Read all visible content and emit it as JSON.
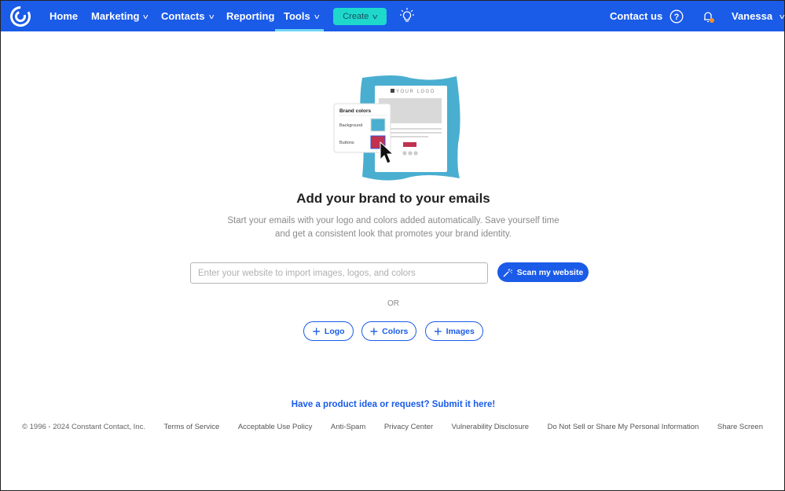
{
  "nav": {
    "items": [
      {
        "label": "Home"
      },
      {
        "label": "Marketing"
      },
      {
        "label": "Contacts"
      },
      {
        "label": "Reporting"
      },
      {
        "label": "Tools"
      }
    ],
    "create_label": "Create",
    "contact_label": "Contact us",
    "user_label": "Vanessa",
    "brand_color": "#1a5be8",
    "create_color": "#1ed8cc",
    "notification_dot_color": "#f7931e"
  },
  "illustration": {
    "logo_text": "YOUR LOGO",
    "panel_title": "Brand colors",
    "row1": "Background",
    "row2": "Buttons",
    "background_color": "#4aaed0",
    "button_color": "#c0324f"
  },
  "main": {
    "title": "Add your brand to your emails",
    "subtitle_line1": "Start your emails with your logo and colors added automatically. Save yourself time",
    "subtitle_line2": "and get a consistent look that promotes your brand identity.",
    "input_placeholder": "Enter your website to import images, logos, and colors",
    "input_value": "",
    "scan_label": "Scan my website",
    "or_label": "OR",
    "logo_label": "Logo",
    "colors_label": "Colors",
    "images_label": "Images",
    "idea_link": "Have a product idea or request? Submit it here!"
  },
  "footer": {
    "copyright": "© 1996 - 2024 Constant Contact, Inc.",
    "links": [
      "Terms of Service",
      "Acceptable Use Policy",
      "Anti-Spam",
      "Privacy Center",
      "Vulnerability Disclosure",
      "Do Not Sell or Share My Personal Information",
      "Share Screen"
    ]
  }
}
